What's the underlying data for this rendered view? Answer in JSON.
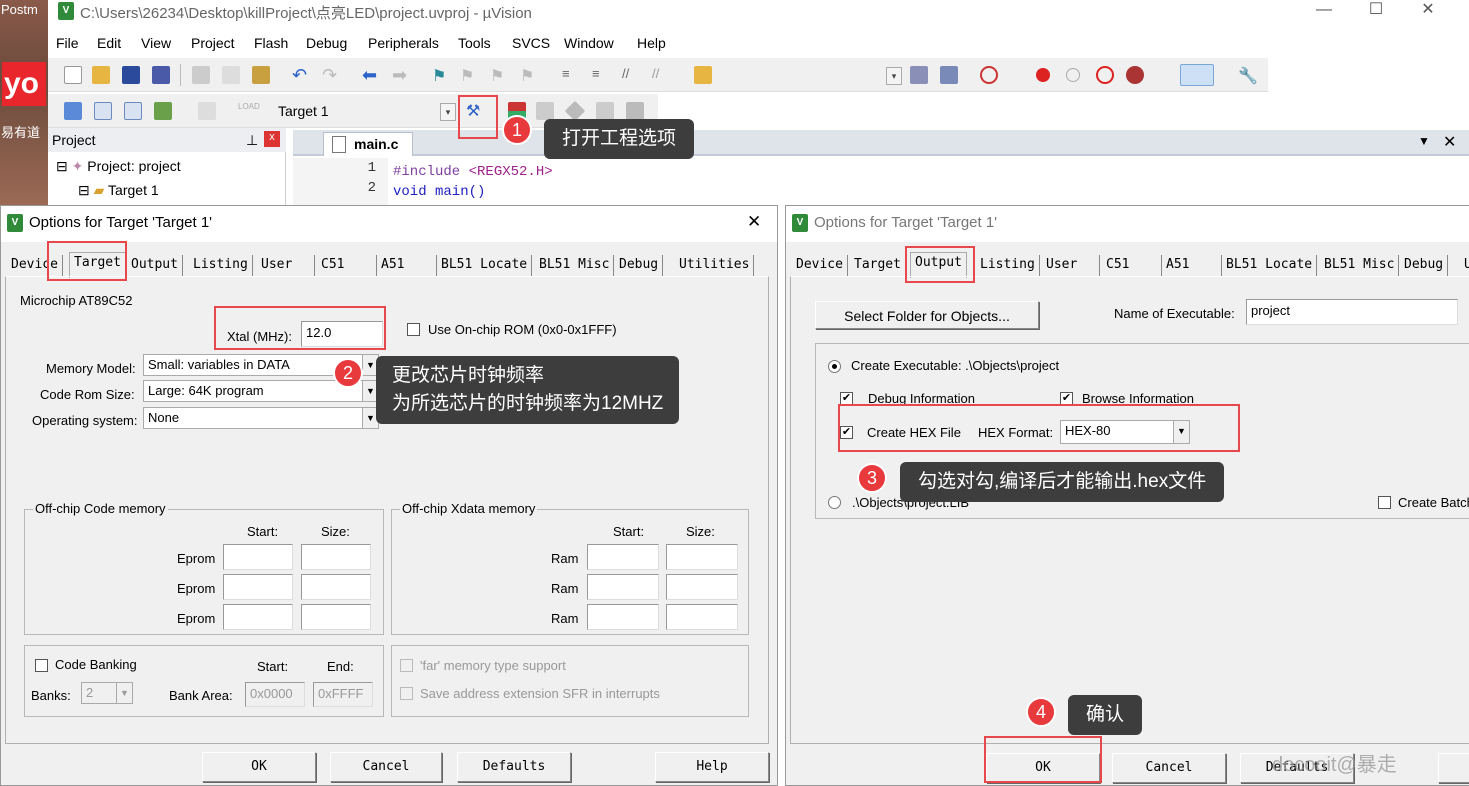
{
  "desktop": {
    "top_label": "Postm",
    "app_label": "易有道",
    "yd_logo": "yo"
  },
  "window": {
    "title": "C:\\Users\\26234\\Desktop\\killProject\\点亮LED\\project.uvproj - µVision",
    "icon": "uvision-icon",
    "minimize": "—",
    "maximize": "☐",
    "close": "✕"
  },
  "menu": [
    "File",
    "Edit",
    "View",
    "Project",
    "Flash",
    "Debug",
    "Peripherals",
    "Tools",
    "SVCS",
    "Window",
    "Help"
  ],
  "toolbar": {
    "target": "Target 1"
  },
  "project_panel": {
    "title": "Project",
    "pin": "⊥",
    "close": "x",
    "root": "Project: project",
    "target": "Target 1"
  },
  "editor": {
    "tab": "main.c",
    "lines": [
      {
        "n": "1",
        "pre": "#include ",
        "arg": "<REGX52.H>"
      },
      {
        "n": "2",
        "pre": "void main()",
        "arg": ""
      }
    ]
  },
  "left_dialog": {
    "title": "Options for Target 'Target 1'",
    "close": "✕",
    "tabs": [
      "Device",
      "Target",
      "Output",
      "Listing",
      "User",
      "C51",
      "A51",
      "BL51 Locate",
      "BL51 Misc",
      "Debug",
      "Utilities"
    ],
    "active_tab": "Target",
    "device": "Microchip AT89C52",
    "xtal_label": "Xtal (MHz):",
    "xtal_value": "12.0",
    "onchip_rom_label": "Use On-chip ROM (0x0-0x1FFF)",
    "onchip_rom_checked": false,
    "memory_model_label": "Memory Model:",
    "memory_model": "Small: variables in DATA",
    "code_rom_label": "Code Rom Size:",
    "code_rom": "Large: 64K program",
    "os_label": "Operating system:",
    "os": "None",
    "code_mem": {
      "title": "Off-chip Code memory",
      "start": "Start:",
      "size": "Size:",
      "rows": [
        "Eprom",
        "Eprom",
        "Eprom"
      ]
    },
    "xdata_mem": {
      "title": "Off-chip Xdata memory",
      "start": "Start:",
      "size": "Size:",
      "rows": [
        "Ram",
        "Ram",
        "Ram"
      ]
    },
    "banking": {
      "label": "Code Banking",
      "start": "Start:",
      "end": "End:",
      "banks_label": "Banks:",
      "banks": "2",
      "bank_area_label": "Bank Area:",
      "bank_start": "0x0000",
      "bank_end": "0xFFFF"
    },
    "far_label": "'far' memory type support",
    "sfr_label": "Save address extension SFR in interrupts",
    "buttons": {
      "ok": "OK",
      "cancel": "Cancel",
      "defaults": "Defaults",
      "help": "Help"
    }
  },
  "right_dialog": {
    "title": "Options for Target 'Target 1'",
    "tabs": [
      "Device",
      "Target",
      "Output",
      "Listing",
      "User",
      "C51",
      "A51",
      "BL51 Locate",
      "BL51 Misc",
      "Debug",
      "U"
    ],
    "active_tab": "Output",
    "select_folder": "Select Folder for Objects...",
    "exe_name_label": "Name of Executable:",
    "exe_name": "project",
    "create_exe_label": "Create Executable:  .\\Objects\\project",
    "debug_info": "Debug Information",
    "browse_info": "Browse Information",
    "create_hex": "Create HEX File",
    "hex_format_label": "HEX Format:",
    "hex_format": "HEX-80",
    "lib_label": ".\\Objects\\project.LIB",
    "create_batch": "Create Batch",
    "buttons": {
      "ok": "OK",
      "cancel": "Cancel",
      "defaults": "Defaults"
    }
  },
  "annotations": [
    {
      "n": "1",
      "text": "打开工程选项"
    },
    {
      "n": "2",
      "text1": "更改芯片时钟频率",
      "text2": "为所选芯片的时钟频率为12MHZ"
    },
    {
      "n": "3",
      "text": "勾选对勾,编译后才能输出.hex文件"
    },
    {
      "n": "4",
      "text": "确认"
    }
  ],
  "watermark": "docooit@暴走",
  "colors": {
    "annotation_red": "#e8393c",
    "callout_bg": "#3d3d3d",
    "dialog_bg": "#f0f0f0"
  }
}
